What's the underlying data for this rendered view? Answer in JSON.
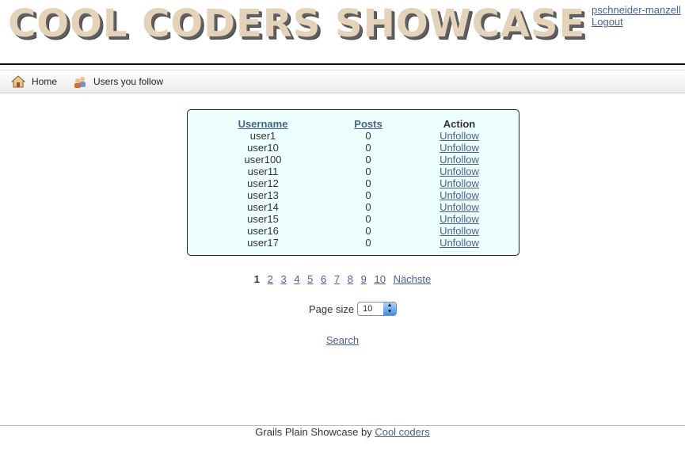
{
  "header": {
    "logo_text": "COOL CODERS SHOWCASE",
    "username": "pschneider-manzell",
    "logout": "Logout"
  },
  "nav": {
    "home": "Home",
    "users_you_follow": "Users you follow",
    "home_icon": "house-icon",
    "follow_icon": "users-icon"
  },
  "table": {
    "headers": {
      "username": "Username",
      "posts": "Posts",
      "action": "Action"
    },
    "rows": [
      {
        "username": "user1",
        "posts": "0",
        "action": "Unfollow"
      },
      {
        "username": "user10",
        "posts": "0",
        "action": "Unfollow"
      },
      {
        "username": "user100",
        "posts": "0",
        "action": "Unfollow"
      },
      {
        "username": "user11",
        "posts": "0",
        "action": "Unfollow"
      },
      {
        "username": "user12",
        "posts": "0",
        "action": "Unfollow"
      },
      {
        "username": "user13",
        "posts": "0",
        "action": "Unfollow"
      },
      {
        "username": "user14",
        "posts": "0",
        "action": "Unfollow"
      },
      {
        "username": "user15",
        "posts": "0",
        "action": "Unfollow"
      },
      {
        "username": "user16",
        "posts": "0",
        "action": "Unfollow"
      },
      {
        "username": "user17",
        "posts": "0",
        "action": "Unfollow"
      }
    ]
  },
  "pager": {
    "current": "1",
    "pages": [
      "2",
      "3",
      "4",
      "5",
      "6",
      "7",
      "8",
      "9",
      "10"
    ],
    "next": "Nächste"
  },
  "page_size": {
    "label": "Page size",
    "value": "10"
  },
  "search": "Search",
  "footer": {
    "text": "Grails Plain Showcase by",
    "link": "Cool coders"
  },
  "colors": {
    "table_bg": "#eeffff",
    "link": "#48609a",
    "logo": "#e4d3b8"
  }
}
